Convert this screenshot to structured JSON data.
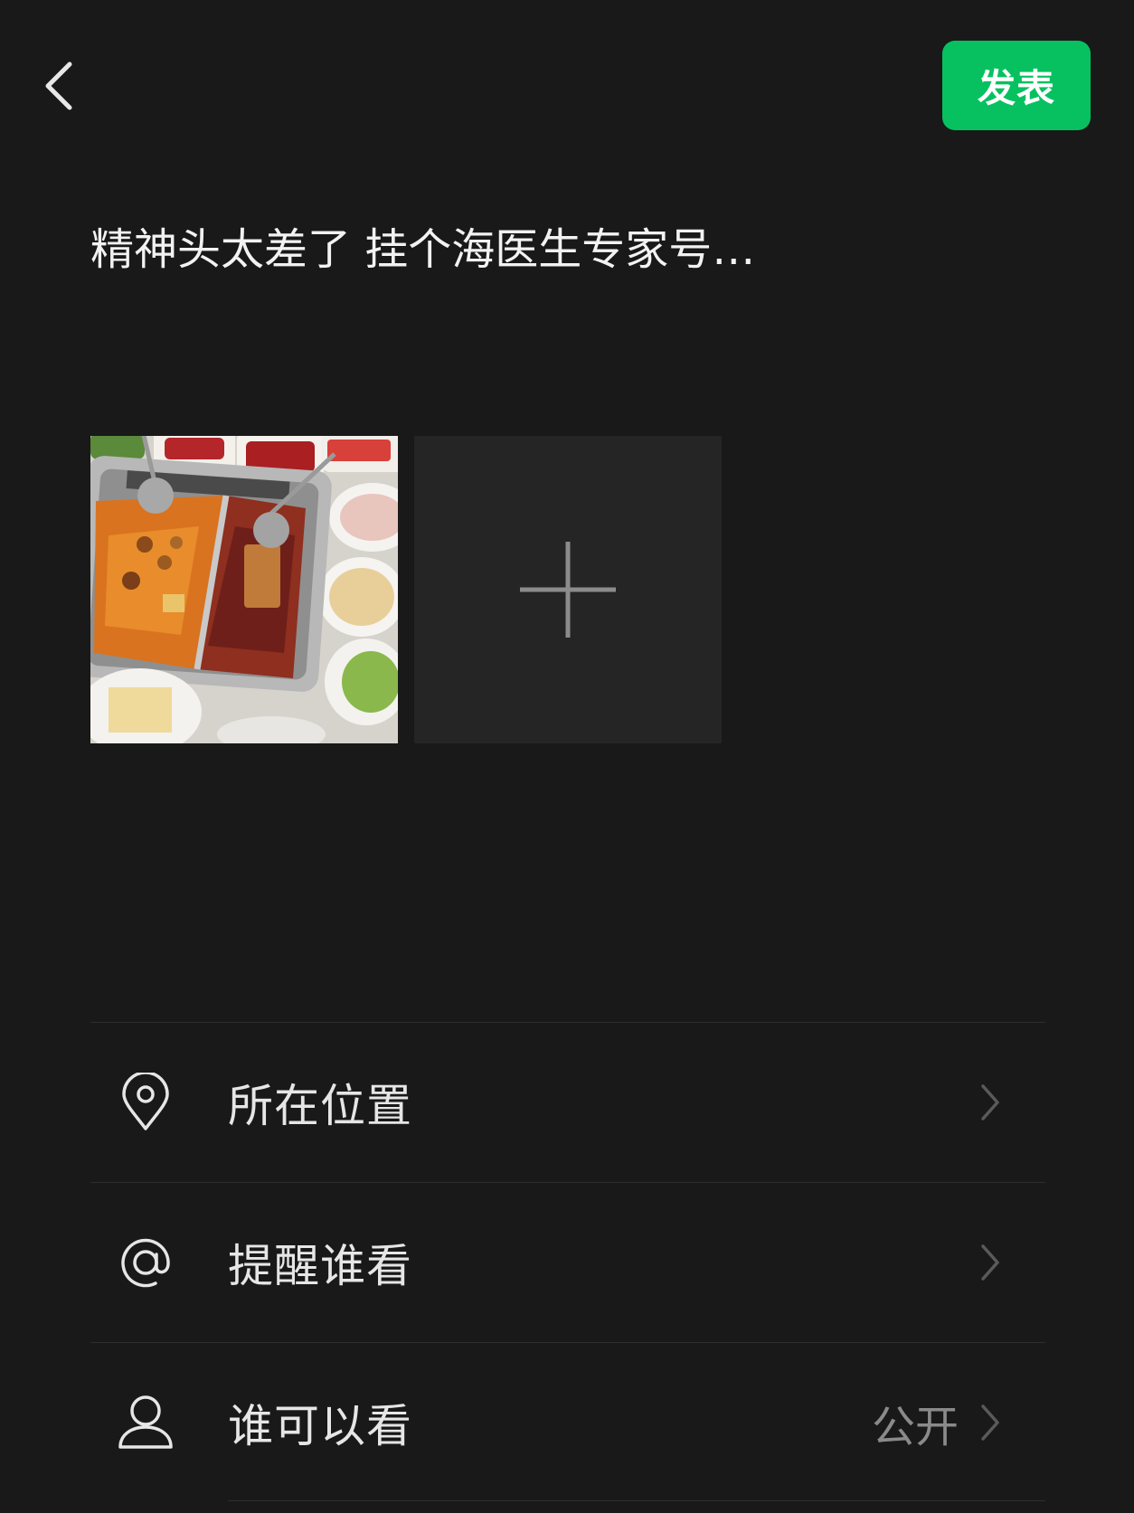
{
  "header": {
    "back_icon": "chevron-left-icon",
    "publish_label": "发表",
    "publish_color": "#07c160"
  },
  "post": {
    "text": "精神头太差了 挂个海医生专家号…"
  },
  "media": {
    "photos": [
      {
        "description_icon": "hotpot-photo"
      }
    ],
    "add_icon": "plus-icon"
  },
  "options": [
    {
      "icon": "location-pin-icon",
      "label": "所在位置",
      "value": ""
    },
    {
      "icon": "at-sign-icon",
      "label": "提醒谁看",
      "value": ""
    },
    {
      "icon": "person-icon",
      "label": "谁可以看",
      "value": "公开"
    }
  ],
  "colors": {
    "background": "#191919",
    "divider": "#2e2e2e",
    "secondary_text": "#8a8a8a"
  }
}
